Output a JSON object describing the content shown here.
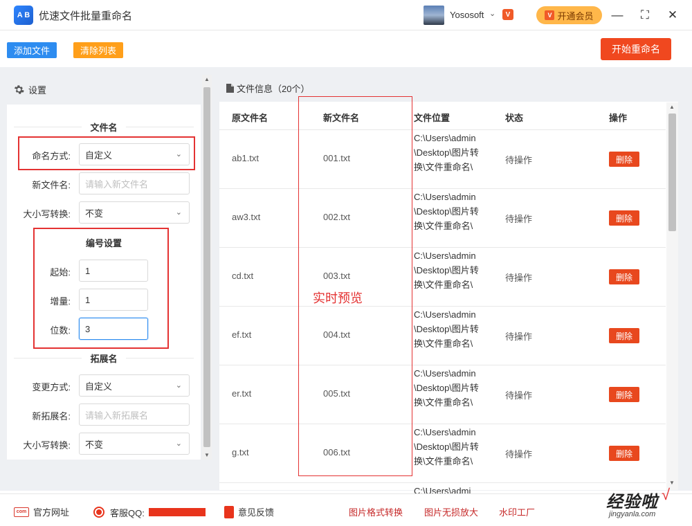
{
  "app": {
    "logo_text": "A B",
    "title": "优速文件批量重命名"
  },
  "user": {
    "name": "Yososoft",
    "vip_label": "开通会员",
    "vip_mini": "V"
  },
  "window": {
    "minimize": "—",
    "maximize": "⛶",
    "close": "✕"
  },
  "toolbar": {
    "add_label": "添加文件",
    "clear_label": "清除列表",
    "start_label": "开始重命名"
  },
  "settings": {
    "title": "设置",
    "filename_section": "文件名",
    "naming_mode_label": "命名方式:",
    "naming_mode_value": "自定义",
    "new_name_label": "新文件名:",
    "new_name_placeholder": "请输入新文件名",
    "case_label": "大小写转换:",
    "case_value": "不变",
    "numbering_section": "编号设置",
    "start_label": "起始:",
    "start_value": "1",
    "increment_label": "增量:",
    "increment_value": "1",
    "digits_label": "位数:",
    "digits_value": "3",
    "ext_section": "拓展名",
    "ext_mode_label": "变更方式:",
    "ext_mode_value": "自定义",
    "new_ext_label": "新拓展名:",
    "new_ext_placeholder": "请输入新拓展名",
    "ext_case_label": "大小写转换:",
    "ext_case_value": "不变"
  },
  "files": {
    "header": "文件信息（20个）",
    "columns": {
      "orig": "原文件名",
      "new": "新文件名",
      "loc": "文件位置",
      "status": "状态",
      "action": "操作"
    },
    "rows": [
      {
        "orig": "ab1.txt",
        "new": "001.txt",
        "loc": "C:\\Users\\admin\\Desktop\\图片转换\\文件重命名\\",
        "status": "待操作",
        "action": "删除"
      },
      {
        "orig": "aw3.txt",
        "new": "002.txt",
        "loc": "C:\\Users\\admin\\Desktop\\图片转换\\文件重命名\\",
        "status": "待操作",
        "action": "删除"
      },
      {
        "orig": "cd.txt",
        "new": "003.txt",
        "loc": "C:\\Users\\admin\\Desktop\\图片转换\\文件重命名\\",
        "status": "待操作",
        "action": "删除"
      },
      {
        "orig": "ef.txt",
        "new": "004.txt",
        "loc": "C:\\Users\\admin\\Desktop\\图片转换\\文件重命名\\",
        "status": "待操作",
        "action": "删除"
      },
      {
        "orig": "er.txt",
        "new": "005.txt",
        "loc": "C:\\Users\\admin\\Desktop\\图片转换\\文件重命名\\",
        "status": "待操作",
        "action": "删除"
      },
      {
        "orig": "g.txt",
        "new": "006.txt",
        "loc": "C:\\Users\\admin\\Desktop\\图片转换\\文件重命名\\",
        "status": "待操作",
        "action": "删除"
      },
      {
        "orig": "",
        "new": "",
        "loc": "C:\\Users\\admi",
        "status": "",
        "action": ""
      }
    ]
  },
  "annotation": {
    "preview": "实时预览"
  },
  "footer": {
    "website": "官方网址",
    "qq": "客服QQ:",
    "feedback": "意见反馈",
    "link1": "图片格式转换",
    "link2": "图片无损放大",
    "link3": "水印工厂",
    "watermark_main": "经验啦",
    "watermark_check": "√",
    "watermark_sub": "jingyanla.com"
  },
  "colors": {
    "primary": "#2d8cf0",
    "orange": "#ff9f1a",
    "danger": "#f0481f",
    "annotation": "#e43232"
  }
}
